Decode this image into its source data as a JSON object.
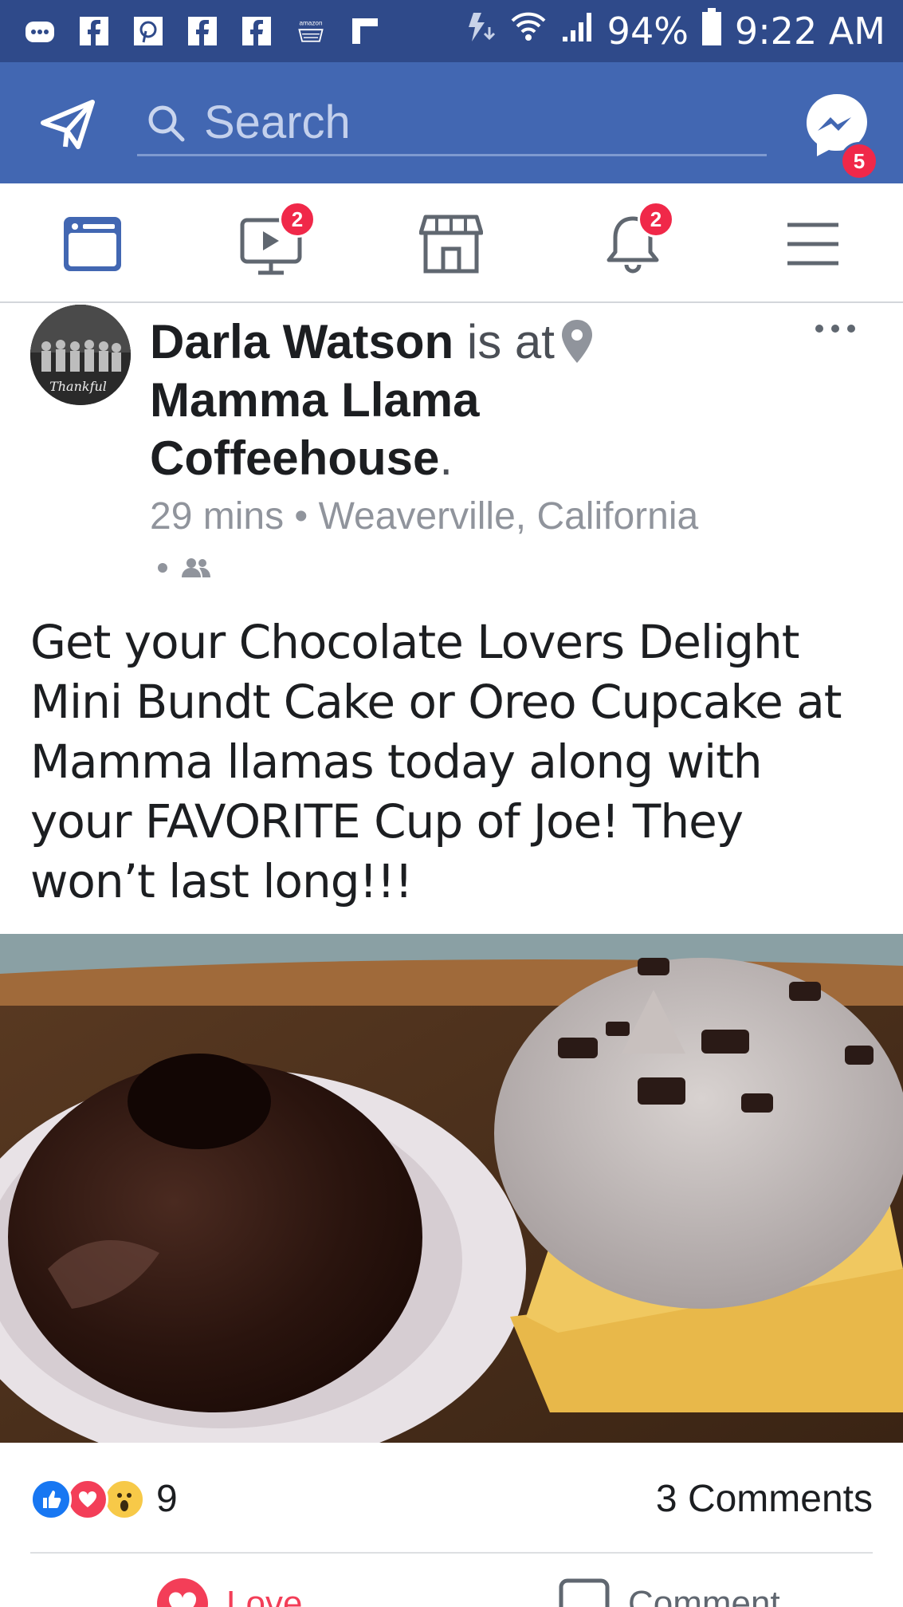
{
  "status_bar": {
    "battery": "94%",
    "time": "9:22 AM",
    "notif_icons": [
      "chat-icon",
      "facebook-icon",
      "pinterest-icon",
      "facebook-icon",
      "facebook-icon",
      "amazon-icon",
      "flipboard-icon"
    ]
  },
  "app_bar": {
    "search_placeholder": "Search",
    "messenger_badge": "5"
  },
  "nav": {
    "items": [
      {
        "name": "news-feed",
        "badge": ""
      },
      {
        "name": "watch",
        "badge": "2"
      },
      {
        "name": "marketplace",
        "badge": ""
      },
      {
        "name": "notifications",
        "badge": "2"
      },
      {
        "name": "menu",
        "badge": ""
      }
    ],
    "active_color": "#4267b2"
  },
  "post": {
    "author": "Darla Watson",
    "is_at": "is at",
    "place_line1": "Mamma Llama",
    "place_line2": "Coffeehouse",
    "period": ".",
    "time": "29 mins",
    "location": "Weaverville, California",
    "avatar_text": "Thankful",
    "text": "Get your Chocolate Lovers Delight Mini Bundt Cake or Oreo Cupcake at Mamma llamas today along with your FAVORITE Cup of Joe! They won’t last long!!!",
    "reaction_count": "9",
    "comments": "3 Comments",
    "love_label": "Love",
    "comment_label": "Comment"
  },
  "colors": {
    "status_bar": "#2f4a8a",
    "app_bar": "#4267b2",
    "badge": "#f02849"
  }
}
